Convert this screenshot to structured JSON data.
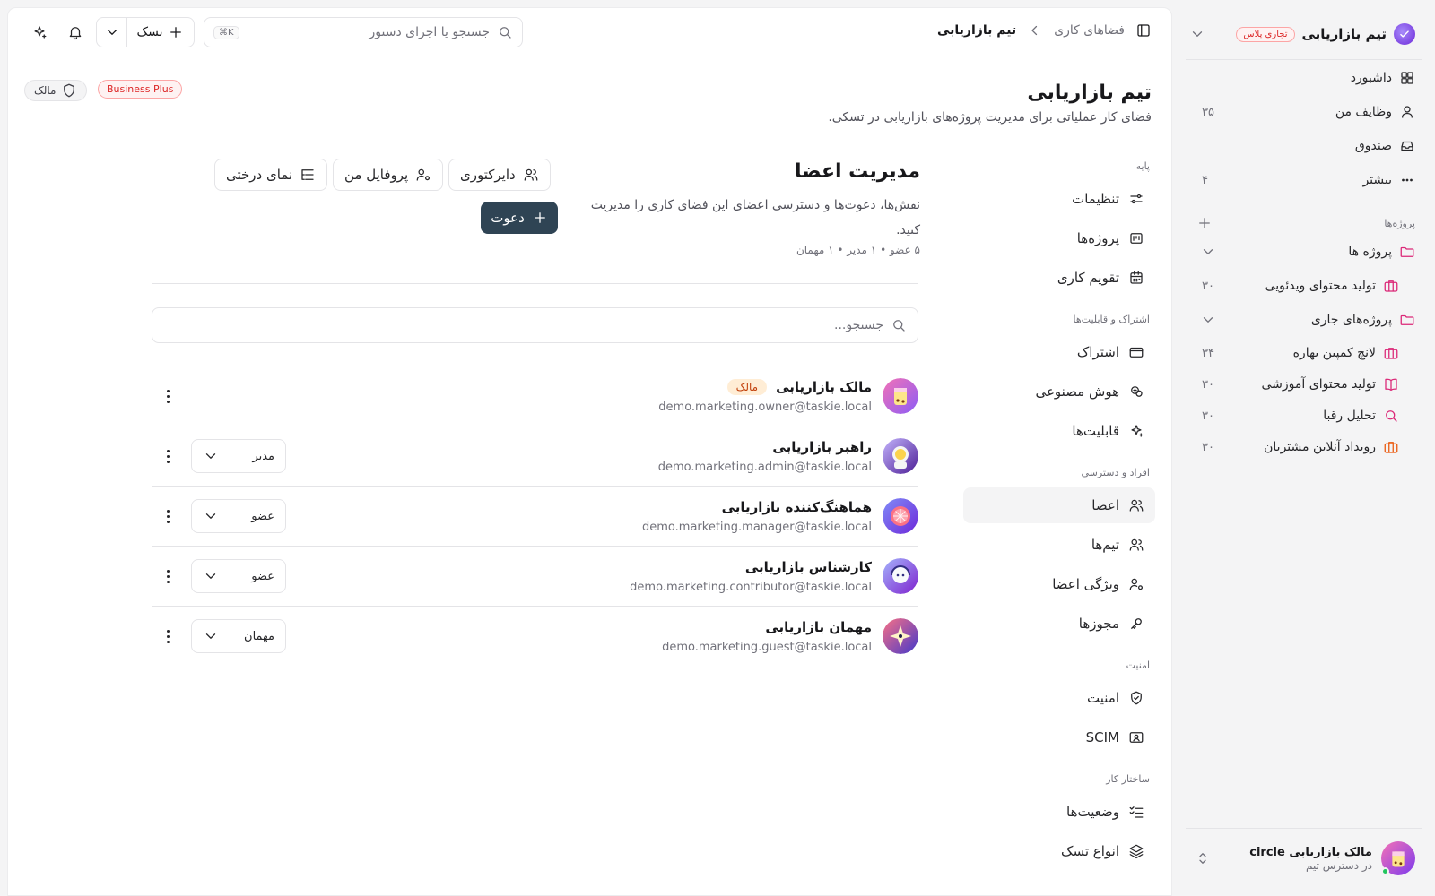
{
  "sidebar": {
    "workspace_name": "تیم بازاریابی",
    "plan_badge": "تجاری پلاس",
    "nav": [
      {
        "label": "داشبورد",
        "count": ""
      },
      {
        "label": "وظایف من",
        "count": "۳۵"
      },
      {
        "label": "صندوق",
        "count": ""
      },
      {
        "label": "بیشتر",
        "count": "۴"
      }
    ],
    "projects_heading": "پروژه‌ها",
    "folders": [
      {
        "label": "پروژه ها"
      },
      {
        "label": "پروژه‌های جاری"
      }
    ],
    "projects": [
      {
        "label": "تولید محتوای ویدئویی",
        "count": "۳۰"
      },
      {
        "label": "لانچ کمپین بهاره",
        "count": "۳۴"
      },
      {
        "label": "تولید محتوای آموزشی",
        "count": "۳۰"
      },
      {
        "label": "تحلیل رقبا",
        "count": "۳۰"
      },
      {
        "label": "رویداد آنلاین مشتریان",
        "count": "۳۰"
      }
    ],
    "user": {
      "name": "مالک بازاریابی circle",
      "role": "در دسترس تیم"
    }
  },
  "topbar": {
    "breadcrumb_root": "فضاهای کاری",
    "breadcrumb_current": "تیم بازاریابی",
    "search_placeholder": "جستجو یا اجرای دستور",
    "search_shortcut": "⌘K",
    "task_button": "تسک"
  },
  "page": {
    "title": "تیم بازاریابی",
    "subtitle": "فضای کار عملیاتی برای مدیریت پروژه‌های بازاریابی در تسکی.",
    "plan_badge": "Business Plus",
    "role_badge": "مالک"
  },
  "settings_nav": {
    "groups": {
      "base": "پایه",
      "subscription": "اشتراک و قابلیت‌ها",
      "people": "افراد و دسترسی",
      "security": "امنیت",
      "structure": "ساختار کار"
    },
    "items": {
      "settings": "تنظیمات",
      "projects": "پروژه‌ها",
      "calendar": "تقویم کاری",
      "subscription": "اشتراک",
      "ai": "هوش مصنوعی",
      "capabilities": "قابلیت‌ها",
      "members": "اعضا",
      "teams": "تیم‌ها",
      "member_attributes": "ویژگی اعضا",
      "permissions": "مجوزها",
      "security": "امنیت",
      "scim": "SCIM",
      "statuses": "وضعیت‌ها",
      "task_types": "انواع تسک"
    }
  },
  "members": {
    "title": "مدیریت اعضا",
    "description": "نقش‌ها، دعوت‌ها و دسترسی اعضای این فضای کاری را مدیریت کنید.",
    "stats": "۵ عضو • ۱ مدیر • ۱ مهمان",
    "buttons": {
      "directory": "دایرکتوری",
      "my_profile": "پروفایل من",
      "tree_view": "نمای درختی",
      "invite": "دعوت"
    },
    "search_placeholder": "جستجو...",
    "owner_tag": "مالک",
    "list": [
      {
        "name": "مالک بازاریابی",
        "email": "demo.marketing.owner@taskie.local",
        "role": ""
      },
      {
        "name": "راهبر بازاریابی",
        "email": "demo.marketing.admin@taskie.local",
        "role": "مدیر"
      },
      {
        "name": "هماهنگ‌کننده بازاریابی",
        "email": "demo.marketing.manager@taskie.local",
        "role": "عضو"
      },
      {
        "name": "کارشناس بازاریابی",
        "email": "demo.marketing.contributor@taskie.local",
        "role": "عضو"
      },
      {
        "name": "مهمان بازاریابی",
        "email": "demo.marketing.guest@taskie.local",
        "role": "مهمان"
      }
    ]
  },
  "colors": {
    "accent_dark": "#2f4454",
    "project_pink": "#db2777",
    "project_orange": "#ea580c",
    "plan_red": "#dc2626"
  }
}
